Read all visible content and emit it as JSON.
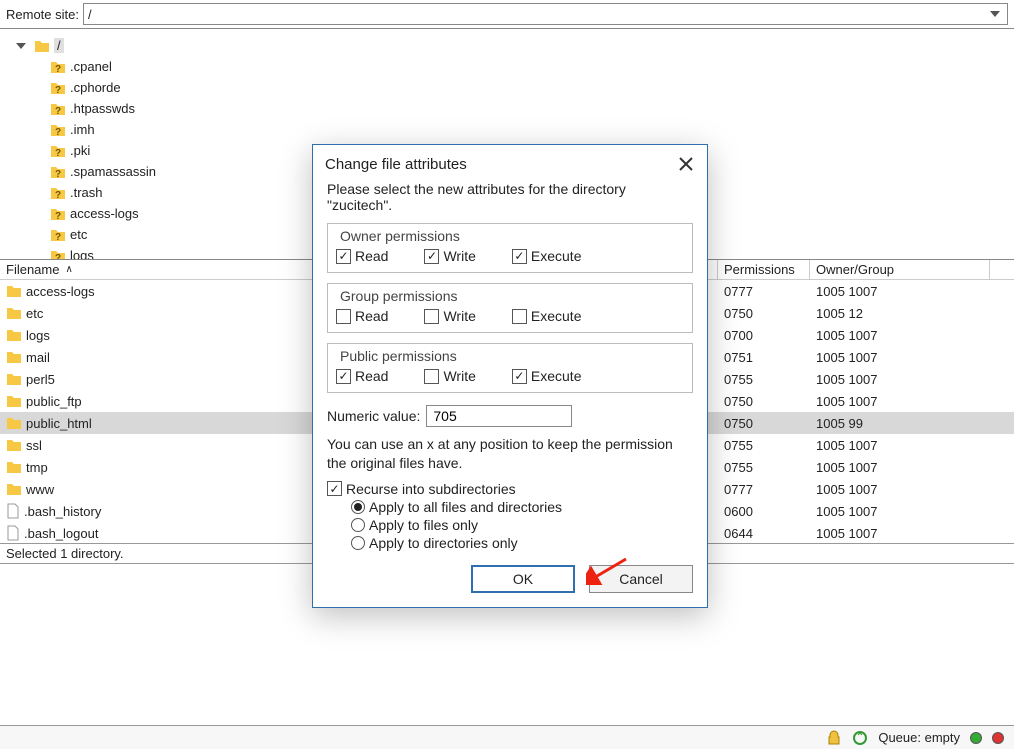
{
  "remote": {
    "label": "Remote site:",
    "path": "/"
  },
  "tree": {
    "root": "/",
    "items": [
      ".cpanel",
      ".cphorde",
      ".htpasswds",
      ".imh",
      ".pki",
      ".spamassassin",
      ".trash",
      "access-logs",
      "etc",
      "logs"
    ]
  },
  "list": {
    "columns": {
      "name": "Filename",
      "perm": "Permissions",
      "own": "Owner/Group"
    },
    "rows": [
      {
        "name": "access-logs",
        "perm": "0777",
        "own": "1005 1007",
        "icon": "folder",
        "sel": false
      },
      {
        "name": "etc",
        "perm": "0750",
        "own": "1005 12",
        "icon": "folder",
        "sel": false
      },
      {
        "name": "logs",
        "perm": "0700",
        "own": "1005 1007",
        "icon": "folder",
        "sel": false
      },
      {
        "name": "mail",
        "perm": "0751",
        "own": "1005 1007",
        "icon": "folder",
        "sel": false
      },
      {
        "name": "perl5",
        "perm": "0755",
        "own": "1005 1007",
        "icon": "folder",
        "sel": false
      },
      {
        "name": "public_ftp",
        "perm": "0750",
        "own": "1005 1007",
        "icon": "folder",
        "sel": false
      },
      {
        "name": "public_html",
        "perm": "0750",
        "own": "1005 99",
        "icon": "folder",
        "sel": true
      },
      {
        "name": "ssl",
        "perm": "0755",
        "own": "1005 1007",
        "icon": "folder",
        "sel": false
      },
      {
        "name": "tmp",
        "perm": "0755",
        "own": "1005 1007",
        "icon": "folder",
        "sel": false
      },
      {
        "name": "www",
        "perm": "0777",
        "own": "1005 1007",
        "icon": "folder",
        "sel": false
      },
      {
        "name": ".bash_history",
        "perm": "0600",
        "own": "1005 1007",
        "icon": "file",
        "sel": false
      },
      {
        "name": ".bash_logout",
        "perm": "0644",
        "own": "1005 1007",
        "icon": "file",
        "sel": false
      }
    ],
    "status": "Selected 1 directory."
  },
  "dialog": {
    "title": "Change file attributes",
    "intro": "Please select the new attributes for the directory \"zucitech\".",
    "owner_legend": "Owner permissions",
    "group_legend": "Group permissions",
    "public_legend": "Public permissions",
    "read": "Read",
    "write": "Write",
    "execute": "Execute",
    "owner": {
      "r": true,
      "w": true,
      "x": true
    },
    "group": {
      "r": false,
      "w": false,
      "x": false
    },
    "public": {
      "r": true,
      "w": false,
      "x": true
    },
    "numeric_label": "Numeric value:",
    "numeric_value": "705",
    "hint": "You can use an x at any position to keep the permission the original files have.",
    "recurse_label": "Recurse into subdirectories",
    "recurse_checked": true,
    "opt_all": "Apply to all files and directories",
    "opt_files": "Apply to files only",
    "opt_dirs": "Apply to directories only",
    "selected_opt": "all",
    "ok": "OK",
    "cancel": "Cancel"
  },
  "statusbar": {
    "queue_label": "Queue: empty"
  }
}
